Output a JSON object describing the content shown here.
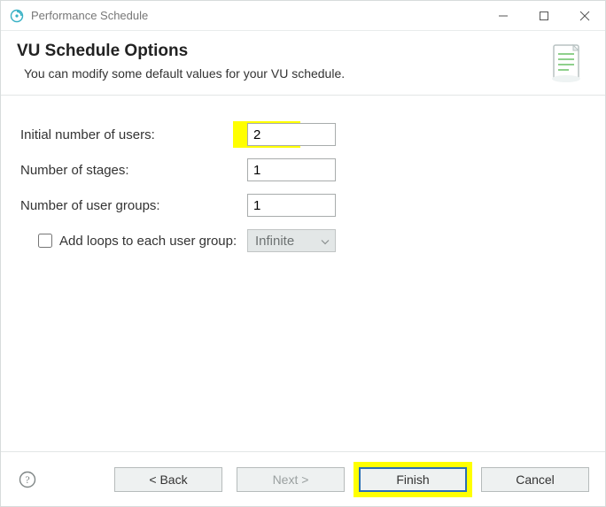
{
  "titlebar": {
    "title": "Performance Schedule"
  },
  "header": {
    "heading": "VU Schedule Options",
    "sub": "You can modify some default values for your VU schedule."
  },
  "form": {
    "initial_users_label": "Initial number of users:",
    "initial_users_value": "2",
    "stages_label": "Number of stages:",
    "stages_value": "1",
    "groups_label": "Number of user groups:",
    "groups_value": "1",
    "loops_label": "Add loops to each user group:",
    "loops_select_value": "Infinite"
  },
  "buttons": {
    "back": "< Back",
    "next": "Next >",
    "finish": "Finish",
    "cancel": "Cancel"
  }
}
